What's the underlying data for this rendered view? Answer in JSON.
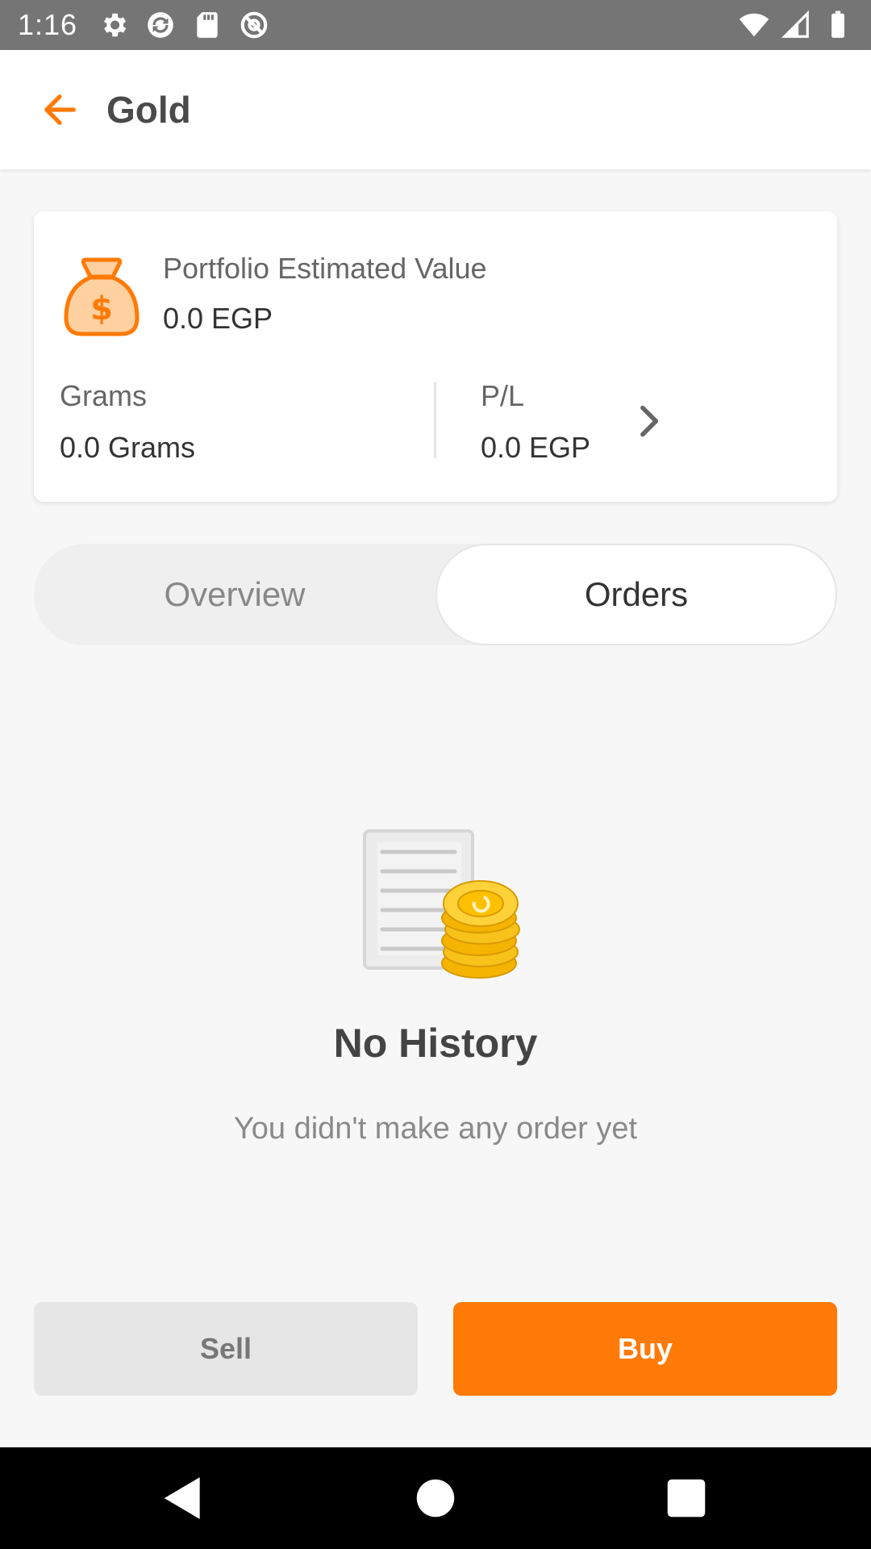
{
  "status_bar": {
    "time": "1:16",
    "left_icons": [
      "gear-icon",
      "sync-icon",
      "sd-card-icon",
      "at-icon"
    ],
    "right_icons": [
      "wifi-icon",
      "signal-icon",
      "battery-icon"
    ]
  },
  "app_bar": {
    "title": "Gold",
    "back_icon": "arrow-left-icon",
    "accent_color": "#ff7a07"
  },
  "portfolio": {
    "icon": "money-bag-icon",
    "label": "Portfolio Estimated Value",
    "value": "0.0 EGP",
    "grams_label": "Grams",
    "grams_value": "0.0 Grams",
    "pl_label": "P/L",
    "pl_value": "0.0 EGP"
  },
  "tabs": [
    {
      "label": "Overview",
      "selected": false
    },
    {
      "label": "Orders",
      "selected": true
    }
  ],
  "empty_state": {
    "icon": "document-coins-icon",
    "title": "No History",
    "subtitle": "You didn't make any order yet"
  },
  "actions": {
    "sell_label": "Sell",
    "buy_label": "Buy",
    "buy_color": "#ff7a07",
    "sell_color": "#e6e6e6"
  },
  "nav_bar": {
    "icons": [
      "nav-back-icon",
      "nav-home-icon",
      "nav-recents-icon"
    ]
  }
}
